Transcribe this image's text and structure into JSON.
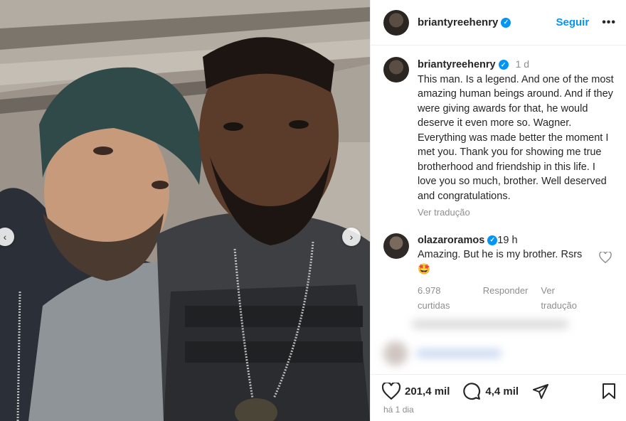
{
  "post": {
    "photo_alt": "",
    "nav_prev": "‹",
    "nav_next": "›"
  },
  "header": {
    "username": "briantyreehenry",
    "verified": "✓",
    "follow_label": "Seguir",
    "more_label": "•••"
  },
  "caption": {
    "username": "briantyreehenry",
    "verified": "✓",
    "time": "1 d",
    "text": "This man. Is a legend. And one of  the most amazing  human beings around. And if they were giving awards for that, he would deserve it even more so. Wagner. Everything was made better the moment I met you. Thank you for showing me true brotherhood and friendship in this life. I love you so much, brother. Well deserved and congratulations.",
    "translate": "Ver tradução"
  },
  "comment": {
    "username": "olazaroramos",
    "verified": "✓",
    "time": "19 h",
    "text": "Amazing. But he is my brother. Rsrs 🤩",
    "likes": "6.978 curtidas",
    "reply": "Responder",
    "translate": "Ver tradução"
  },
  "footer": {
    "like_count": "201,4 mil",
    "comment_count": "4,4 mil",
    "time_ago": "há 1 dia"
  },
  "icons": {
    "verified": "verified-badge-icon",
    "heart": "heart-icon",
    "comment": "comment-icon",
    "share": "share-icon",
    "bookmark": "bookmark-icon"
  },
  "colors": {
    "accent": "#0095f6",
    "muted": "#8e8e8e",
    "text": "#262626"
  }
}
